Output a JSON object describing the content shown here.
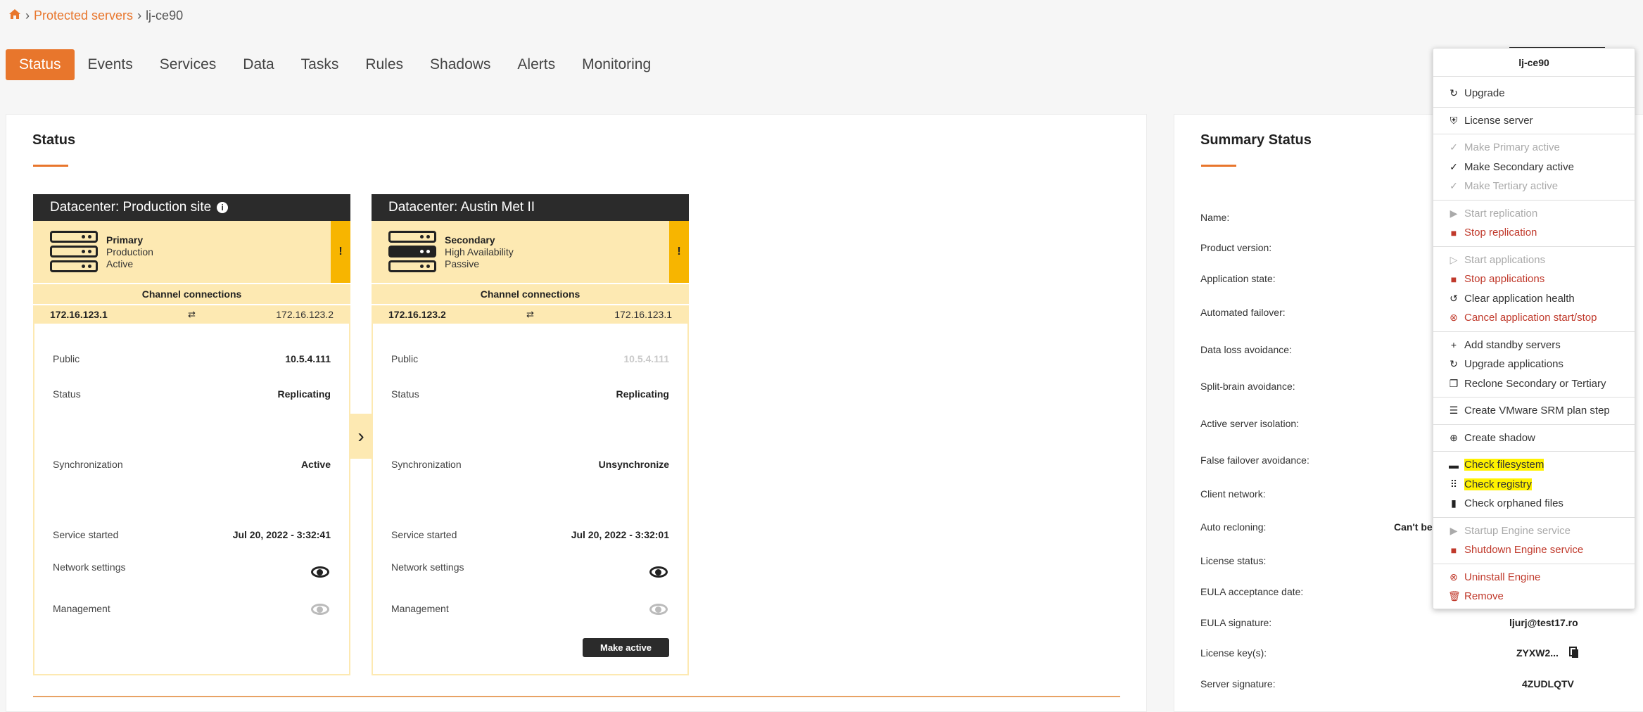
{
  "breadcrumb": {
    "home_icon": "home-icon",
    "link": "Protected servers",
    "current": "lj-ce90",
    "sep": "›"
  },
  "tabs": [
    "Status",
    "Events",
    "Services",
    "Data",
    "Tasks",
    "Rules",
    "Shadows",
    "Alerts",
    "Monitoring"
  ],
  "status_panel": {
    "title": "Status",
    "datacenters": [
      {
        "header": "Datacenter: Production site",
        "role": "Primary",
        "sub1": "Production",
        "sub2": "Active",
        "warning": "!",
        "channel_title": "Channel connections",
        "channel_left": "172.16.123.1",
        "channel_right": "172.16.123.2",
        "rows": [
          {
            "label": "Public",
            "value": "10.5.4.111"
          },
          {
            "label": "Status",
            "value": "Replicating"
          },
          {
            "label": "Synchronization",
            "value": "Active"
          },
          {
            "label": "Service started",
            "value": "Jul 20, 2022 - 3:32:41"
          },
          {
            "label": "Network settings",
            "value": ""
          },
          {
            "label": "Management",
            "value": ""
          }
        ]
      },
      {
        "header": "Datacenter: Austin Met II",
        "role": "Secondary",
        "sub1": "High Availability",
        "sub2": "Passive",
        "warning": "!",
        "channel_title": "Channel connections",
        "channel_left": "172.16.123.2",
        "channel_right": "172.16.123.1",
        "rows": [
          {
            "label": "Public",
            "value": "10.5.4.111"
          },
          {
            "label": "Status",
            "value": "Replicating"
          },
          {
            "label": "Synchronization",
            "value": "Unsynchronize"
          },
          {
            "label": "Service started",
            "value": "Jul 20, 2022 - 3:32:01"
          },
          {
            "label": "Network settings",
            "value": ""
          },
          {
            "label": "Management",
            "value": ""
          }
        ],
        "make_active": "Make active"
      }
    ]
  },
  "summary_panel": {
    "title": "Summary Status",
    "labels": [
      "Name:",
      "Product version:",
      "Application state:",
      "Automated failover:",
      "Data loss avoidance:",
      "Split-brain avoidance:",
      "Active server isolation:",
      "False failover avoidance:",
      "Client network:",
      "Auto recloning:",
      "License status:",
      "EULA acceptance date:",
      "EULA signature:",
      "License key(s):",
      "Server signature:"
    ],
    "auto_recloning_value": "Can't be",
    "eula_signature_value": "ljurj@test17.ro",
    "license_key_value": "ZYXW2...",
    "server_signature_value": "4ZUDLQTV"
  },
  "menu": {
    "title": "lj-ce90",
    "groups": [
      [
        {
          "label": "Upgrade",
          "icon": "upgrade-icon",
          "state": "normal"
        }
      ],
      [
        {
          "label": "License server",
          "icon": "shield-check-icon",
          "state": "normal"
        }
      ],
      [
        {
          "label": "Make Primary active",
          "icon": "check-icon",
          "state": "disabled"
        },
        {
          "label": "Make Secondary active",
          "icon": "check-icon",
          "state": "normal"
        },
        {
          "label": "Make Tertiary active",
          "icon": "check-icon",
          "state": "disabled"
        }
      ],
      [
        {
          "label": "Start replication",
          "icon": "play-icon",
          "state": "disabled"
        },
        {
          "label": "Stop replication",
          "icon": "stop-icon",
          "state": "red"
        }
      ],
      [
        {
          "label": "Start applications",
          "icon": "play-circle-icon",
          "state": "disabled"
        },
        {
          "label": "Stop applications",
          "icon": "stop-icon",
          "state": "red"
        },
        {
          "label": "Clear application health",
          "icon": "undo-icon",
          "state": "normal"
        },
        {
          "label": "Cancel application start/stop",
          "icon": "cancel-circle-icon",
          "state": "red"
        }
      ],
      [
        {
          "label": "Add standby servers",
          "icon": "plus-icon",
          "state": "normal"
        },
        {
          "label": "Upgrade applications",
          "icon": "upgrade-icon",
          "state": "normal"
        },
        {
          "label": "Reclone Secondary or Tertiary",
          "icon": "copy-icon",
          "state": "normal"
        }
      ],
      [
        {
          "label": "Create VMware SRM plan step",
          "icon": "list-icon",
          "state": "normal"
        }
      ],
      [
        {
          "label": "Create shadow",
          "icon": "add-circle-icon",
          "state": "normal"
        }
      ],
      [
        {
          "label": "Check filesystem",
          "icon": "folder-icon",
          "state": "highlight"
        },
        {
          "label": "Check registry",
          "icon": "grid-icon",
          "state": "highlight"
        },
        {
          "label": "Check orphaned files",
          "icon": "file-icon",
          "state": "normal"
        }
      ],
      [
        {
          "label": "Startup Engine service",
          "icon": "play-icon",
          "state": "disabled"
        },
        {
          "label": "Shutdown Engine service",
          "icon": "stop-icon",
          "state": "red"
        }
      ],
      [
        {
          "label": "Uninstall Engine",
          "icon": "cancel-circle-icon",
          "state": "red"
        },
        {
          "label": "Remove",
          "icon": "trash-icon",
          "state": "red"
        }
      ]
    ]
  },
  "colors": {
    "accent": "#e8762c",
    "warning": "#f7b500",
    "panel_tint": "#fde9b2",
    "highlight": "#fff200",
    "danger": "#c0392b"
  }
}
